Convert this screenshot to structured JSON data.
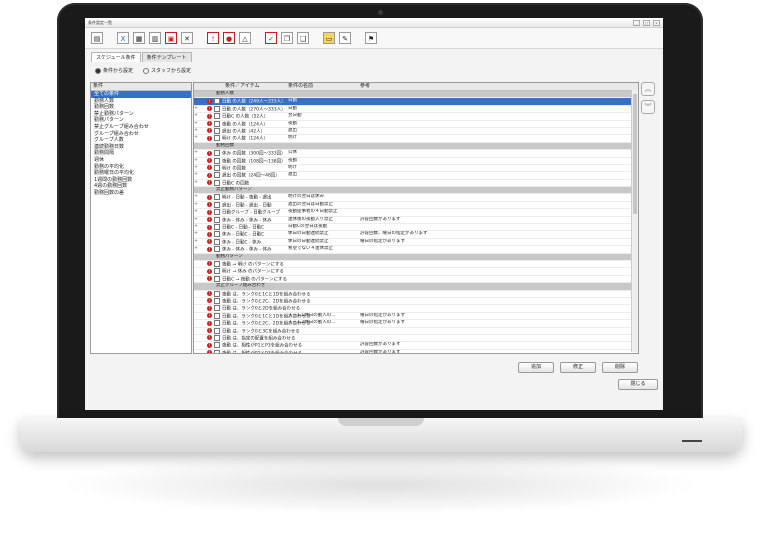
{
  "window": {
    "title": "条件設定一覧"
  },
  "tabs": [
    "スケジュール条件",
    "条件テンプレート"
  ],
  "radios": [
    "条件から設定",
    "スタッフから設定"
  ],
  "left_panel": {
    "header": "条件",
    "items": [
      "全ての条件",
      "勤務人数",
      "勤務回数",
      "禁止勤務パターン",
      "勤務パターン",
      "禁止グループ組み合わせ",
      "グループ組み合わせ",
      "グループ人数",
      "連続勤務日数",
      "勤務間隔",
      "週休",
      "勤務の平均化",
      "勤務曜日の平均化",
      "1週間の勤務回数",
      "4週の勤務回数",
      "勤務回数の差"
    ]
  },
  "grid": {
    "headers": [
      "条件／アイテム",
      "条件の名前",
      "参考"
    ],
    "rows": [
      {
        "kind": "section",
        "item": "勤務人数"
      },
      {
        "kind": "hl",
        "mark": "+",
        "item": "日勤 の人数（249人〜333人）",
        "name": "日勤",
        "ref": ""
      },
      {
        "kind": "row",
        "mark": "+",
        "item": "日勤 の人数（270人〜333人）",
        "name": "日勤",
        "ref": ""
      },
      {
        "kind": "row",
        "mark": "+",
        "item": "日勤C の人数（52人）",
        "name": "翌日勤",
        "ref": ""
      },
      {
        "kind": "row",
        "mark": "+",
        "item": "夜勤 の人数（124人）",
        "name": "夜勤",
        "ref": ""
      },
      {
        "kind": "row",
        "mark": "+",
        "item": "遅出 の人数（42人）",
        "name": "遅出",
        "ref": ""
      },
      {
        "kind": "row",
        "mark": "+",
        "item": "明け の人数（124人）",
        "name": "明け",
        "ref": ""
      },
      {
        "kind": "section",
        "item": "勤務回数"
      },
      {
        "kind": "row",
        "mark": "+",
        "item": "休み の回数（300回〜333回）",
        "name": "公休",
        "ref": ""
      },
      {
        "kind": "row",
        "mark": "+",
        "item": "夜勤 の回数（108回〜138回）",
        "name": "夜勤",
        "ref": ""
      },
      {
        "kind": "row",
        "mark": "+",
        "item": "明け の回数",
        "name": "明け",
        "ref": ""
      },
      {
        "kind": "row",
        "mark": "+",
        "item": "遅出 の回数（24回〜48回）",
        "name": "遅出",
        "ref": ""
      },
      {
        "kind": "row",
        "mark": "+",
        "item": "日勤C の回数",
        "name": "",
        "ref": ""
      },
      {
        "kind": "section",
        "item": "禁止勤務パターン"
      },
      {
        "kind": "row",
        "mark": "+",
        "item": "明け - 日勤 - 夜勤 - 遅出",
        "name": "明けの翌日は休み",
        "ref": ""
      },
      {
        "kind": "row",
        "mark": "+",
        "item": "遅出 - 日勤 - 遅出 - 日勤",
        "name": "遅出の翌日は日勤禁止",
        "ref": ""
      },
      {
        "kind": "row",
        "mark": "+",
        "item": "日勤グループ - 日勤グループ",
        "name": "夜勤従事者の４日勤禁止",
        "ref": ""
      },
      {
        "kind": "row",
        "mark": "+",
        "item": "休み - 休み - 休み - 休み",
        "name": "連休後の夜勤入り禁止",
        "ref": "許容回数があります"
      },
      {
        "kind": "row",
        "mark": "+",
        "item": "日勤C - 日勤 - 日勤C",
        "name": "日勤Cの翌日は夜勤",
        "ref": ""
      },
      {
        "kind": "row",
        "mark": "+",
        "item": "休み - 日勤C - 日勤C",
        "name": "休日の日勤連続禁止",
        "ref": "許容回数、曜日の指定があります"
      },
      {
        "kind": "row",
        "mark": "+",
        "item": "休み - 日勤C - 休み",
        "name": "休日の日勤連続禁止",
        "ref": "曜日の指定があります"
      },
      {
        "kind": "row",
        "mark": "+",
        "item": "休み - 休み - 休み - 休み",
        "name": "希望でない４連休禁止",
        "ref": ""
      },
      {
        "kind": "section",
        "item": "勤務パターン"
      },
      {
        "kind": "row",
        "mark": "",
        "item": "夜勤 → 明け のパターンにする",
        "name": "",
        "ref": ""
      },
      {
        "kind": "row",
        "mark": "",
        "item": "明け → 休み のパターンにする",
        "name": "",
        "ref": ""
      },
      {
        "kind": "row",
        "mark": "",
        "item": "日勤C → 夜勤 のパターンにする",
        "name": "",
        "ref": ""
      },
      {
        "kind": "section",
        "item": "禁止グループ組み合わせ"
      },
      {
        "kind": "row",
        "mark": "",
        "item": "夜勤 は、ランク0と1Cと1Dを組み合わせる",
        "name": "",
        "ref": ""
      },
      {
        "kind": "row",
        "mark": "",
        "item": "夜勤 は、ランク0と2C、2Dを組み合わせる",
        "name": "",
        "ref": ""
      },
      {
        "kind": "row",
        "mark": "",
        "item": "日勤 は、ランク0と2Dを組み合わせる",
        "name": "",
        "ref": ""
      },
      {
        "kind": "row",
        "mark": "",
        "item": "日勤 は、ランク0と1Cと1Dを組み合わせる",
        "name": "チーム1休日の勤人の...",
        "ref": "曜日の指定があります"
      },
      {
        "kind": "row",
        "mark": "",
        "item": "日勤 は、ランク0と2C、2Dを組み合わせる",
        "name": "チーム2休日の勤人の...",
        "ref": "曜日の指定があります"
      },
      {
        "kind": "row",
        "mark": "",
        "item": "日勤 は、ランク0と3Cを組み合わせる",
        "name": "",
        "ref": ""
      },
      {
        "kind": "row",
        "mark": "",
        "item": "日勤 は、指定の配置を組み合わせる",
        "name": "",
        "ref": ""
      },
      {
        "kind": "row",
        "mark": "",
        "item": "夜勤 は、相性がP1とP3を組み合わせる",
        "name": "",
        "ref": "許容回数があります"
      },
      {
        "kind": "row",
        "mark": "",
        "item": "夜勤 は、相性がP2とP3を組み合わせる",
        "name": "",
        "ref": "許容回数があります"
      }
    ]
  },
  "buttons": {
    "add": "追加",
    "edit": "修正",
    "delete": "削除",
    "close": "閉じる"
  }
}
